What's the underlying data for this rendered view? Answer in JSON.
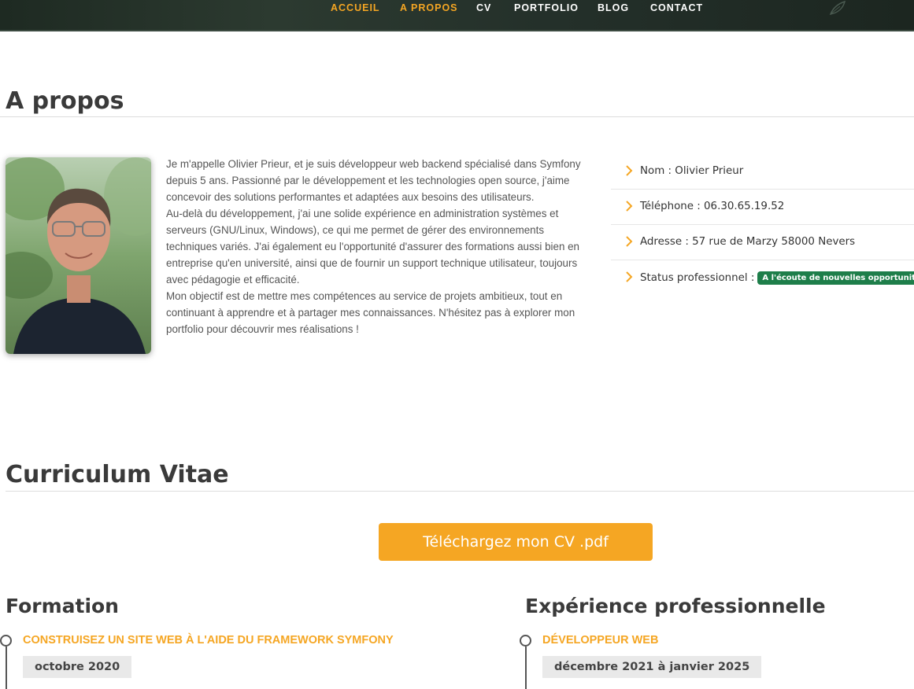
{
  "nav": {
    "items": [
      {
        "label": "ACCUEIL"
      },
      {
        "label": "A PROPOS"
      },
      {
        "label": "CV"
      },
      {
        "label": "PORTFOLIO"
      },
      {
        "label": "BLOG"
      },
      {
        "label": "CONTACT"
      }
    ],
    "active": "A PROPOS"
  },
  "about": {
    "title": "A propos",
    "paragraphs": [
      "Je m'appelle Olivier Prieur, et je suis développeur web backend spécialisé dans Symfony depuis 5 ans. Passionné par le développement et les technologies open source, j'aime concevoir des solutions performantes et adaptées aux besoins des utilisateurs.",
      "Au-delà du développement, j'ai une solide expérience en administration systèmes et serveurs (GNU/Linux, Windows), ce qui me permet de gérer des environnements techniques variés. J'ai également eu l'opportunité d'assurer des formations aussi bien en entreprise qu'en université, ainsi que de fournir un support technique utilisateur, toujours avec pédagogie et efficacité.",
      "Mon objectif est de mettre mes compétences au service de projets ambitieux, tout en continuant à apprendre et à partager mes connaissances. N'hésitez pas à explorer mon portfolio pour découvrir mes réalisations !"
    ],
    "info": [
      {
        "text": "Nom : Olivier Prieur"
      },
      {
        "text": "Téléphone : 06.30.65.19.52"
      },
      {
        "text": "Adresse : 57 rue de Marzy 58000 Nevers"
      },
      {
        "text": "Status professionnel :",
        "badge": "A l'écoute de nouvelles opportunités"
      }
    ]
  },
  "cv": {
    "title": "Curriculum Vitae",
    "download_label": "Téléchargez mon CV .pdf",
    "formation": {
      "title": "Formation",
      "items": [
        {
          "title": "Construisez un site web à l'aide du framework Symfony",
          "date": "octobre 2020"
        }
      ]
    },
    "experience": {
      "title": "Expérience professionnelle",
      "items": [
        {
          "title": "Développeur web",
          "date": "décembre 2021 à janvier 2025"
        }
      ]
    }
  },
  "colors": {
    "accent": "#f5a623",
    "badge": "#1e7e4a",
    "nav_bg": "#24302a"
  },
  "icons": {
    "info_bullet": "chevron-right-icon",
    "nav_decoration": "leaf-icon"
  }
}
